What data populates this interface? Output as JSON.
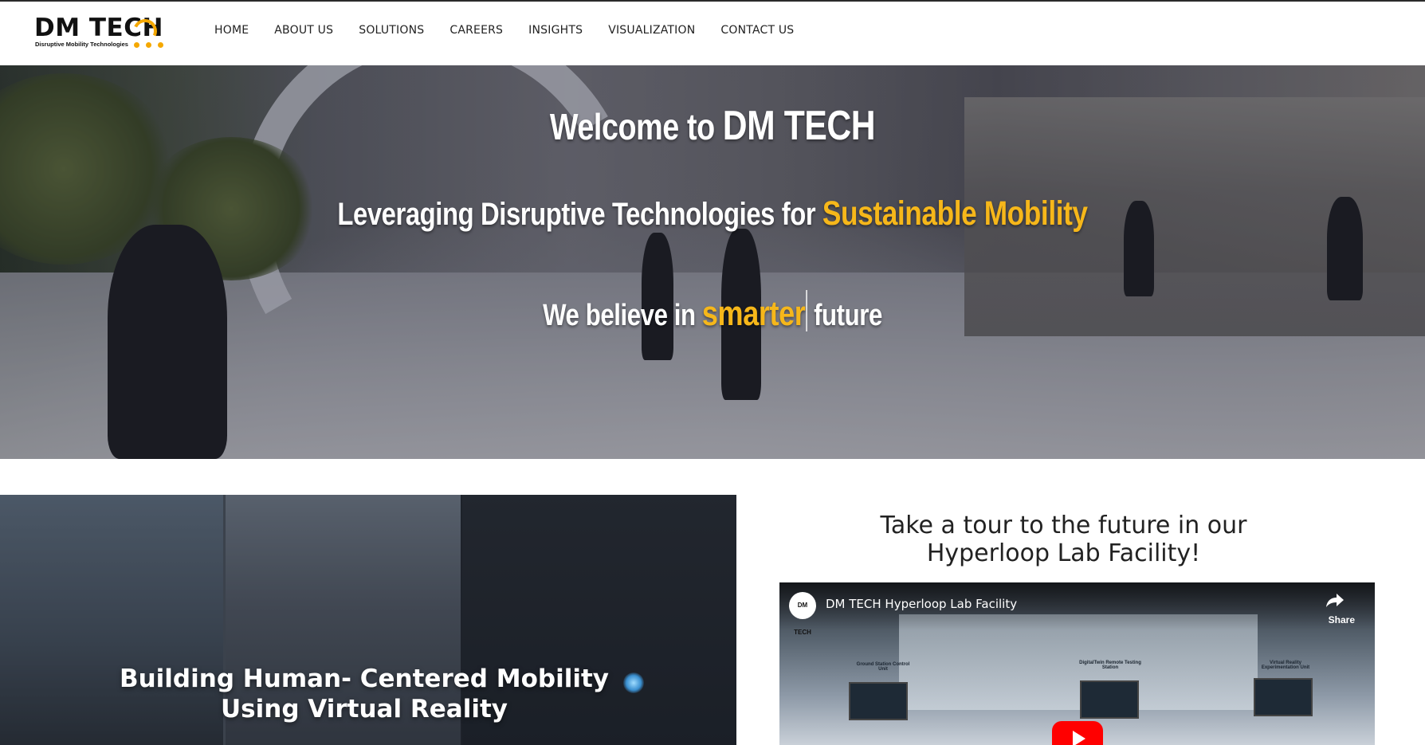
{
  "brand": {
    "name": "DM TECH",
    "tagline": "Disruptive Mobility Technologies",
    "accent_color": "#f6b71a"
  },
  "nav": {
    "items": [
      {
        "label": "HOME"
      },
      {
        "label": "ABOUT US"
      },
      {
        "label": "SOLUTIONS"
      },
      {
        "label": "CAREERS"
      },
      {
        "label": "INSIGHTS"
      },
      {
        "label": "VISUALIZATION"
      },
      {
        "label": "CONTACT US"
      }
    ]
  },
  "hero": {
    "welcome_prefix": "Welcome to",
    "welcome_brand": "DM TECH",
    "tagline_prefix": "Leveraging Disruptive Technologies for",
    "tagline_highlight": "Sustainable Mobility",
    "belief_prefix": "We believe in",
    "belief_highlight": "smarter",
    "belief_suffix": "future"
  },
  "vr_panel": {
    "title_line1": "Building Human- Centered Mobility",
    "title_line2": "Using Virtual Reality"
  },
  "tour": {
    "title_line1": "Take a tour to the future in our",
    "title_line2": "Hyperloop Lab Facility!"
  },
  "video": {
    "channel_avatar": "DM TECH",
    "title": "DM TECH Hyperloop Lab Facility",
    "share_label": "Share",
    "share_icon": "share-arrow-icon",
    "play_icon": "youtube-play-icon",
    "labels": {
      "ground_station": "Ground Station Control Unit",
      "digital_twin": "DigitalTwin Remote Testing Station",
      "vr_unit": "Virtual Reality Experimentation Unit"
    }
  }
}
